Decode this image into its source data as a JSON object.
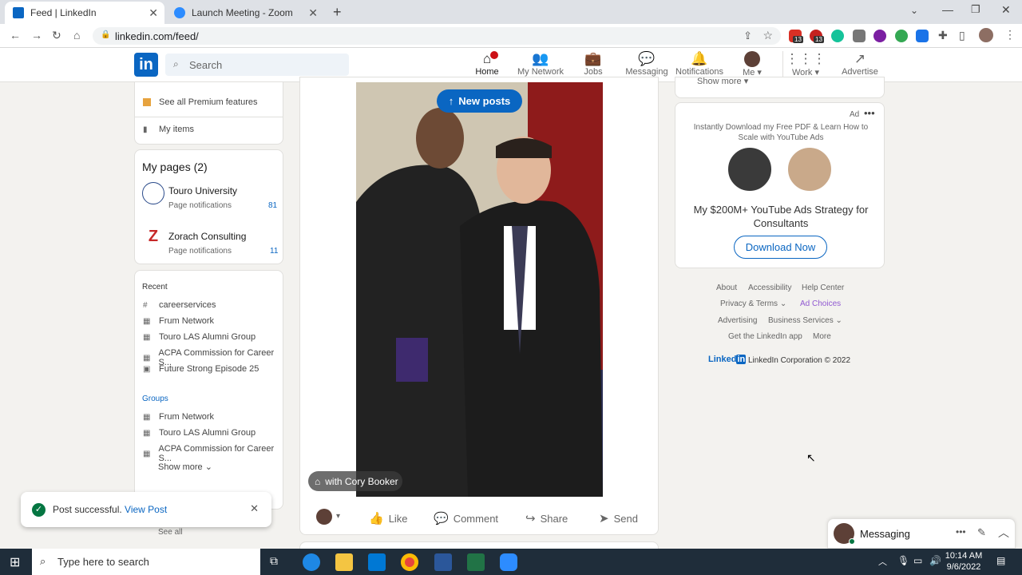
{
  "browser": {
    "tabs": [
      {
        "label": "Feed | LinkedIn"
      },
      {
        "label": "Launch Meeting - Zoom"
      }
    ],
    "url": "linkedin.com/feed/",
    "ext_badges": [
      "13",
      "13"
    ]
  },
  "header": {
    "search_placeholder": "Search",
    "nav": [
      {
        "label": "Home",
        "badge": ""
      },
      {
        "label": "My Network"
      },
      {
        "label": "Jobs"
      },
      {
        "label": "Messaging"
      },
      {
        "label": "Notifications"
      },
      {
        "label": "Me"
      },
      {
        "label": "Work"
      },
      {
        "label": "Advertise"
      }
    ]
  },
  "left": {
    "premium": "See all Premium features",
    "my_items": "My items",
    "my_pages_title": "My pages (2)",
    "pages": [
      {
        "name": "Touro University",
        "sub": "Page notifications",
        "count": "81"
      },
      {
        "name": "Zorach Consulting",
        "sub": "Page notifications",
        "count": "11"
      }
    ],
    "recent_title": "Recent",
    "recent": [
      "careerservices",
      "Frum Network",
      "Touro LAS Alumni Group",
      "ACPA Commission for Career S...",
      "Future Strong Episode 25"
    ],
    "groups_title": "Groups",
    "groups": [
      "Frum Network",
      "Touro LAS Alumni Group",
      "ACPA Commission for Career S..."
    ],
    "show_more": "Show more",
    "see_all": "See all"
  },
  "post": {
    "new_posts": "New posts",
    "tag": "with Cory Booker",
    "actions": [
      "Like",
      "Comment",
      "Share",
      "Send"
    ]
  },
  "right": {
    "show_more": "Show more",
    "ad_label": "Ad",
    "ad_text": "Instantly Download my Free PDF & Learn How to Scale with YouTube Ads",
    "ad_title": "My $200M+ YouTube Ads Strategy for Consultants",
    "ad_button": "Download Now",
    "footer": {
      "about": "About",
      "accessibility": "Accessibility",
      "help": "Help Center",
      "privacy": "Privacy & Terms",
      "adchoices": "Ad Choices",
      "advertising": "Advertising",
      "business": "Business Services",
      "app": "Get the LinkedIn app",
      "more": "More",
      "copyright": "LinkedIn Corporation © 2022"
    }
  },
  "toast": {
    "text": "Post successful.",
    "link": "View Post"
  },
  "messaging": {
    "label": "Messaging"
  },
  "taskbar": {
    "search": "Type here to search",
    "time": "10:14 AM",
    "date": "9/6/2022"
  }
}
